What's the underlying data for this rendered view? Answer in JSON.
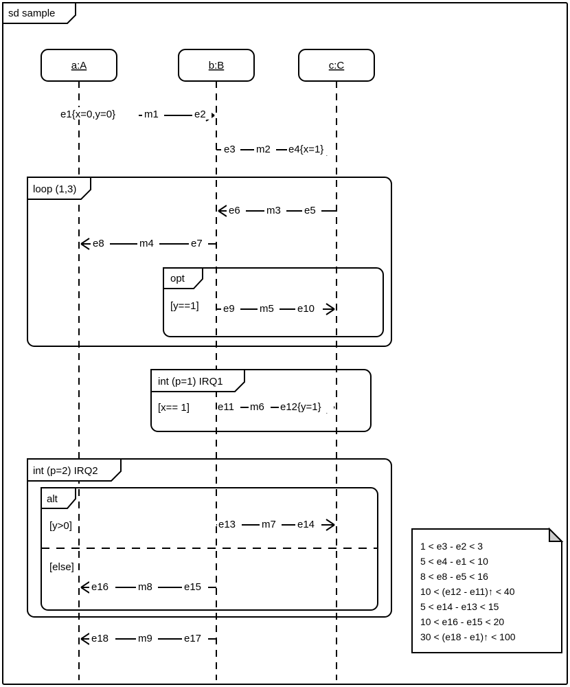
{
  "title": "sd sample",
  "lifelines": [
    {
      "id": "a",
      "label": "a:A"
    },
    {
      "id": "b",
      "label": "b:B"
    },
    {
      "id": "c",
      "label": "c:C"
    }
  ],
  "messages": [
    {
      "id": "m1",
      "label": "m1",
      "from_event": "e1{x=0,y=0}",
      "to_event": "e2"
    },
    {
      "id": "m2",
      "label": "m2",
      "from_event": "e3",
      "to_event": "e4{x=1}"
    },
    {
      "id": "m3",
      "label": "m3",
      "from_event": "e6",
      "to_event": "e5"
    },
    {
      "id": "m4",
      "label": "m4",
      "from_event": "e8",
      "to_event": "e7"
    },
    {
      "id": "m5",
      "label": "m5",
      "from_event": "e9",
      "to_event": "e10"
    },
    {
      "id": "m6",
      "label": "m6",
      "from_event": "e11",
      "to_event": "e12{y=1}"
    },
    {
      "id": "m7",
      "label": "m7",
      "from_event": "e13",
      "to_event": "e14"
    },
    {
      "id": "m8",
      "label": "m8",
      "from_event": "e16",
      "to_event": "e15"
    },
    {
      "id": "m9",
      "label": "m9",
      "from_event": "e18",
      "to_event": "e17"
    }
  ],
  "fragments": {
    "loop": {
      "label": "loop (1,3)"
    },
    "opt": {
      "label": "opt",
      "guard": "[y==1]"
    },
    "int1": {
      "label": "int (p=1) IRQ1",
      "guard": "[x== 1]"
    },
    "int2": {
      "label": "int (p=2) IRQ2"
    },
    "alt": {
      "label": "alt",
      "guard1": "[y>0]",
      "guard2": "[else]"
    }
  },
  "constraints": [
    "1 < e3 - e2 < 3",
    "5 < e4 - e1 < 10",
    "8 < e8 - e5 < 16",
    "10 < (e12 - e11)↑ < 40",
    "5 < e14 - e13 < 15",
    "10 < e16 - e15 < 20",
    "30 < (e18 - e1)↑ < 100"
  ]
}
